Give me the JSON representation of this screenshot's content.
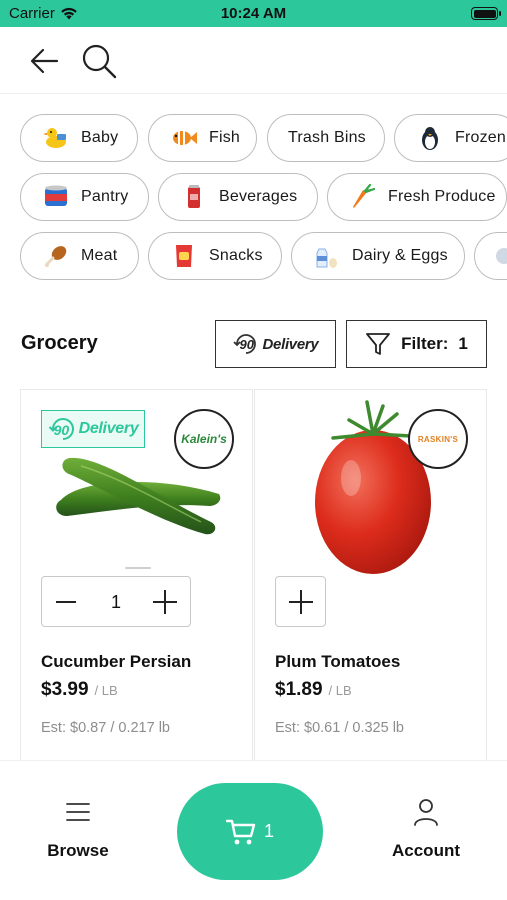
{
  "status_bar": {
    "carrier": "Carrier",
    "time": "10:24 AM"
  },
  "nav": {
    "back_icon": "arrow-left-icon",
    "search_icon": "search-icon"
  },
  "categories": [
    {
      "label": "Baby",
      "icon": "duck-toy-icon"
    },
    {
      "label": "Fish",
      "icon": "fish-icon"
    },
    {
      "label": "Trash Bins",
      "icon": ""
    },
    {
      "label": "Frozen",
      "icon": "penguin-icon"
    },
    {
      "label": "Pantry",
      "icon": "can-icon"
    },
    {
      "label": "Beverages",
      "icon": "soda-can-icon"
    },
    {
      "label": "Fresh Produce",
      "icon": "carrot-icon"
    },
    {
      "label": "Meat",
      "icon": "drumstick-icon"
    },
    {
      "label": "Snacks",
      "icon": "chips-bag-icon"
    },
    {
      "label": "Dairy & Eggs",
      "icon": "milk-icon"
    }
  ],
  "grocery_bar": {
    "title": "Grocery",
    "delivery_button": {
      "minutes": "90",
      "label": "Delivery"
    },
    "filter_button": {
      "label": "Filter:",
      "count": "1"
    }
  },
  "products": [
    {
      "name": "Cucumber Persian",
      "price": "$3.99",
      "unit": "/ LB",
      "estimate": "Est: $0.87 / 0.217 lb",
      "store": "Kalein's",
      "delivery_badge": {
        "minutes": "90",
        "label": "Delivery"
      },
      "quantity": "1",
      "in_cart": true
    },
    {
      "name": "Plum Tomatoes",
      "price": "$1.89",
      "unit": "/ LB",
      "estimate": "Est: $0.61 / 0.325 lb",
      "store": "RASKIN'S",
      "in_cart": false
    }
  ],
  "bottom_bar": {
    "browse": {
      "label": "Browse",
      "icon": "menu-icon"
    },
    "cart": {
      "count": "1",
      "icon": "cart-icon"
    },
    "account": {
      "label": "Account",
      "icon": "person-icon"
    }
  },
  "colors": {
    "accent": "#2dc79c",
    "border": "#bdbdbd",
    "muted": "#8d8d8d"
  }
}
